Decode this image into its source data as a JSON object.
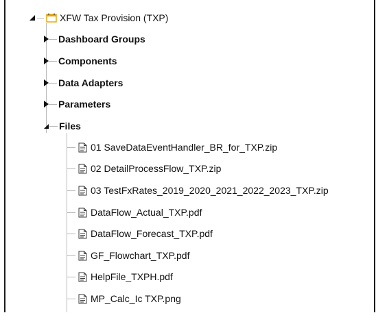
{
  "tree": {
    "root": {
      "label": "XFW Tax Provision (TXP)",
      "icon": "calendar-folder-icon",
      "expanded": true
    },
    "children": [
      {
        "label": "Dashboard Groups",
        "expanded": false
      },
      {
        "label": "Components",
        "expanded": false
      },
      {
        "label": "Data Adapters",
        "expanded": false
      },
      {
        "label": "Parameters",
        "expanded": false
      },
      {
        "label": "Files",
        "expanded": true
      }
    ],
    "files": [
      "01 SaveDataEventHandler_BR_for_TXP.zip",
      "02 DetailProcessFlow_TXP.zip",
      "03 TestFxRates_2019_2020_2021_2022_2023_TXP.zip",
      "DataFlow_Actual_TXP.pdf",
      "DataFlow_Forecast_TXP.pdf",
      "GF_Flowchart_TXP.pdf",
      "HelpFile_TXPH.pdf",
      "MP_Calc_Ic    TXP.png"
    ]
  },
  "colors": {
    "accent": "#e8a200",
    "line": "#b8b8b8"
  }
}
